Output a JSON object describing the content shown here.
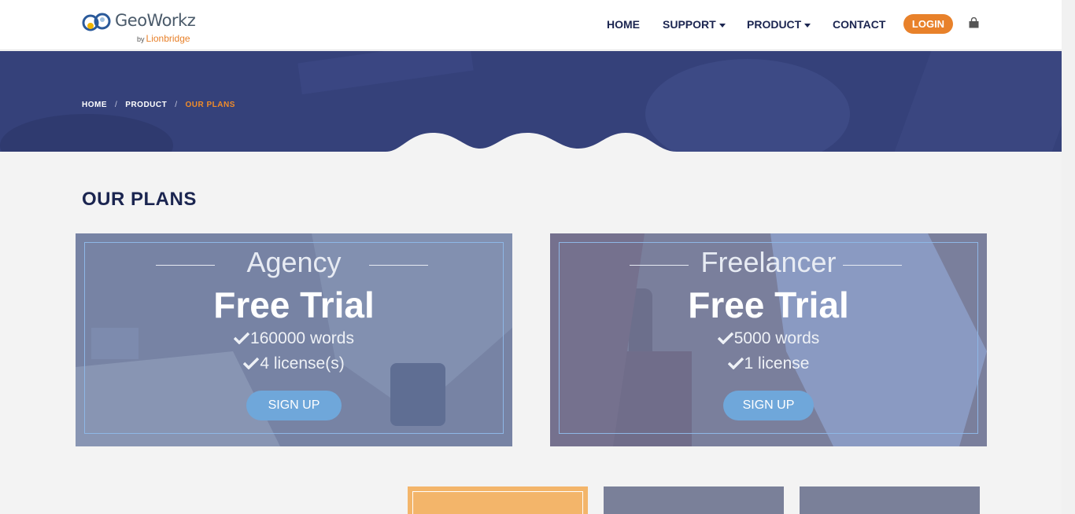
{
  "brand": {
    "name": "GeoWorkz",
    "by": "by",
    "sub": "Lionbridge"
  },
  "nav": {
    "home": "HOME",
    "support": "SUPPORT",
    "product": "PRODUCT",
    "contact": "CONTACT",
    "login": "LOGIN",
    "cart_icon": "shopping-bag-icon"
  },
  "breadcrumb": {
    "home": "HOME",
    "sep": "/",
    "product": "PRODUCT",
    "current": "OUR PLANS"
  },
  "section": {
    "title": "OUR PLANS"
  },
  "plans": [
    {
      "name": "Agency",
      "trial": "Free Trial",
      "features": [
        "160000 words",
        "4 license(s)"
      ],
      "button": "SIGN UP"
    },
    {
      "name": "Freelancer",
      "trial": "Free Trial",
      "features": [
        "5000 words",
        "1 license"
      ],
      "button": "SIGN UP"
    }
  ],
  "colors": {
    "accent": "#e8812a",
    "navy": "#1b2550",
    "hero": "#35417a",
    "button": "#6fa7da"
  }
}
